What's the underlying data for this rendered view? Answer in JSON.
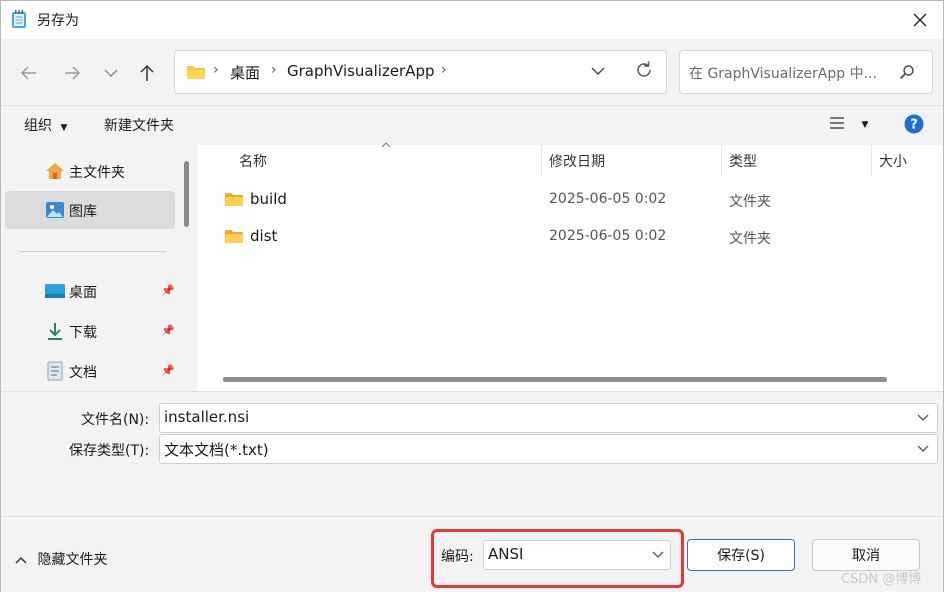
{
  "window": {
    "title": "另存为"
  },
  "nav": {
    "breadcrumb": [
      "桌面",
      "GraphVisualizerApp"
    ],
    "search_placeholder": "在 GraphVisualizerApp 中..."
  },
  "toolbar": {
    "organize": "组织",
    "new_folder": "新建文件夹"
  },
  "sidebar": {
    "items": [
      {
        "label": "主文件夹",
        "icon": "home-icon",
        "pinned": false,
        "selected": false
      },
      {
        "label": "图库",
        "icon": "gallery-icon",
        "pinned": false,
        "selected": true
      },
      {
        "label": "桌面",
        "icon": "desktop-icon",
        "pinned": true,
        "selected": false
      },
      {
        "label": "下载",
        "icon": "download-icon",
        "pinned": true,
        "selected": false
      },
      {
        "label": "文档",
        "icon": "document-icon",
        "pinned": true,
        "selected": false
      }
    ]
  },
  "columns": {
    "name": "名称",
    "modified": "修改日期",
    "type": "类型",
    "size": "大小"
  },
  "files": [
    {
      "name": "build",
      "modified": "2025-06-05 0:02",
      "type": "文件夹"
    },
    {
      "name": "dist",
      "modified": "2025-06-05 0:02",
      "type": "文件夹"
    }
  ],
  "form": {
    "filename_label": "文件名(N):",
    "filename_value": "installer.nsi",
    "filetype_label": "保存类型(T):",
    "filetype_value": "文本文档(*.txt)"
  },
  "footer": {
    "hide_folders": "隐藏文件夹",
    "encoding_label": "编码:",
    "encoding_value": "ANSI",
    "save": "保存(S)",
    "cancel": "取消",
    "watermark": "CSDN @博博"
  },
  "colors": {
    "accent": "#2f6fca",
    "highlight_box": "#e53935",
    "folder": "#f6c343"
  }
}
